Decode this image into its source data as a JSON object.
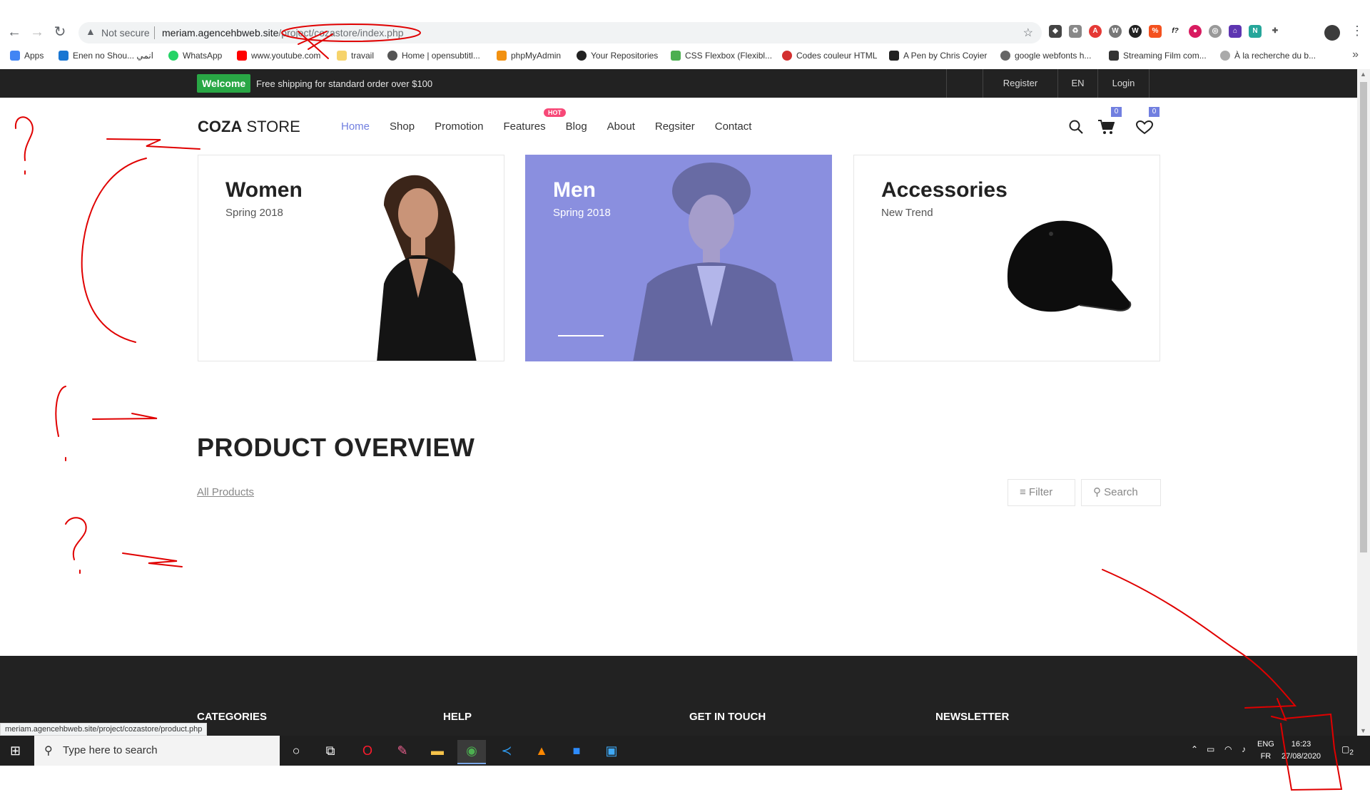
{
  "browser": {
    "security_label": "Not secure",
    "url_host": "meriam.agencehbweb.site",
    "url_path": "/project/cozastore/index.php",
    "status_url": "meriam.agencehbweb.site/project/cozastore/product.php",
    "bookmarks": [
      "Apps",
      "Enen no Shou... انمي",
      "WhatsApp",
      "www.youtube.com",
      "travail",
      "Home | opensubtitl...",
      "phpMyAdmin",
      "Your Repositories",
      "CSS Flexbox (Flexibl...",
      "Codes couleur HTML",
      "A Pen by Chris Coyier",
      "google webfonts h...",
      "Streaming Film com...",
      "À la recherche du b..."
    ]
  },
  "topbar": {
    "welcome": "Welcome",
    "shipping": "Free shipping for standard order over $100",
    "links": [
      "Register",
      "EN",
      "Login"
    ]
  },
  "header": {
    "logo_bold": "COZA",
    "logo_rest": " STORE",
    "menu": [
      "Home",
      "Shop",
      "Promotion",
      "Features",
      "Blog",
      "About",
      "Regsiter",
      "Contact"
    ],
    "hot_badge": "HOT",
    "cart_count": "0",
    "wishlist_count": "0"
  },
  "banners": [
    {
      "title": "Women",
      "subtitle": "Spring 2018"
    },
    {
      "title": "Men",
      "subtitle": "Spring 2018"
    },
    {
      "title": "Accessories",
      "subtitle": "New Trend"
    }
  ],
  "products": {
    "title": "PRODUCT OVERVIEW",
    "all_products": "All Products",
    "filter_label": "Filter",
    "search_label": "Search"
  },
  "footer": {
    "headings": [
      "CATEGORIES",
      "HELP",
      "GET IN TOUCH",
      "NEWSLETTER"
    ]
  },
  "taskbar": {
    "search_placeholder": "Type here to search",
    "lang_top": "ENG",
    "lang_bottom": "FR",
    "time": "16:23",
    "date": "27/08/2020",
    "notif_count": "2"
  },
  "colors": {
    "accent": "#717fe0",
    "welcome_green": "#29a745",
    "hot_pink": "#f74877",
    "dark": "#222222",
    "annotation_red": "#e00000"
  }
}
